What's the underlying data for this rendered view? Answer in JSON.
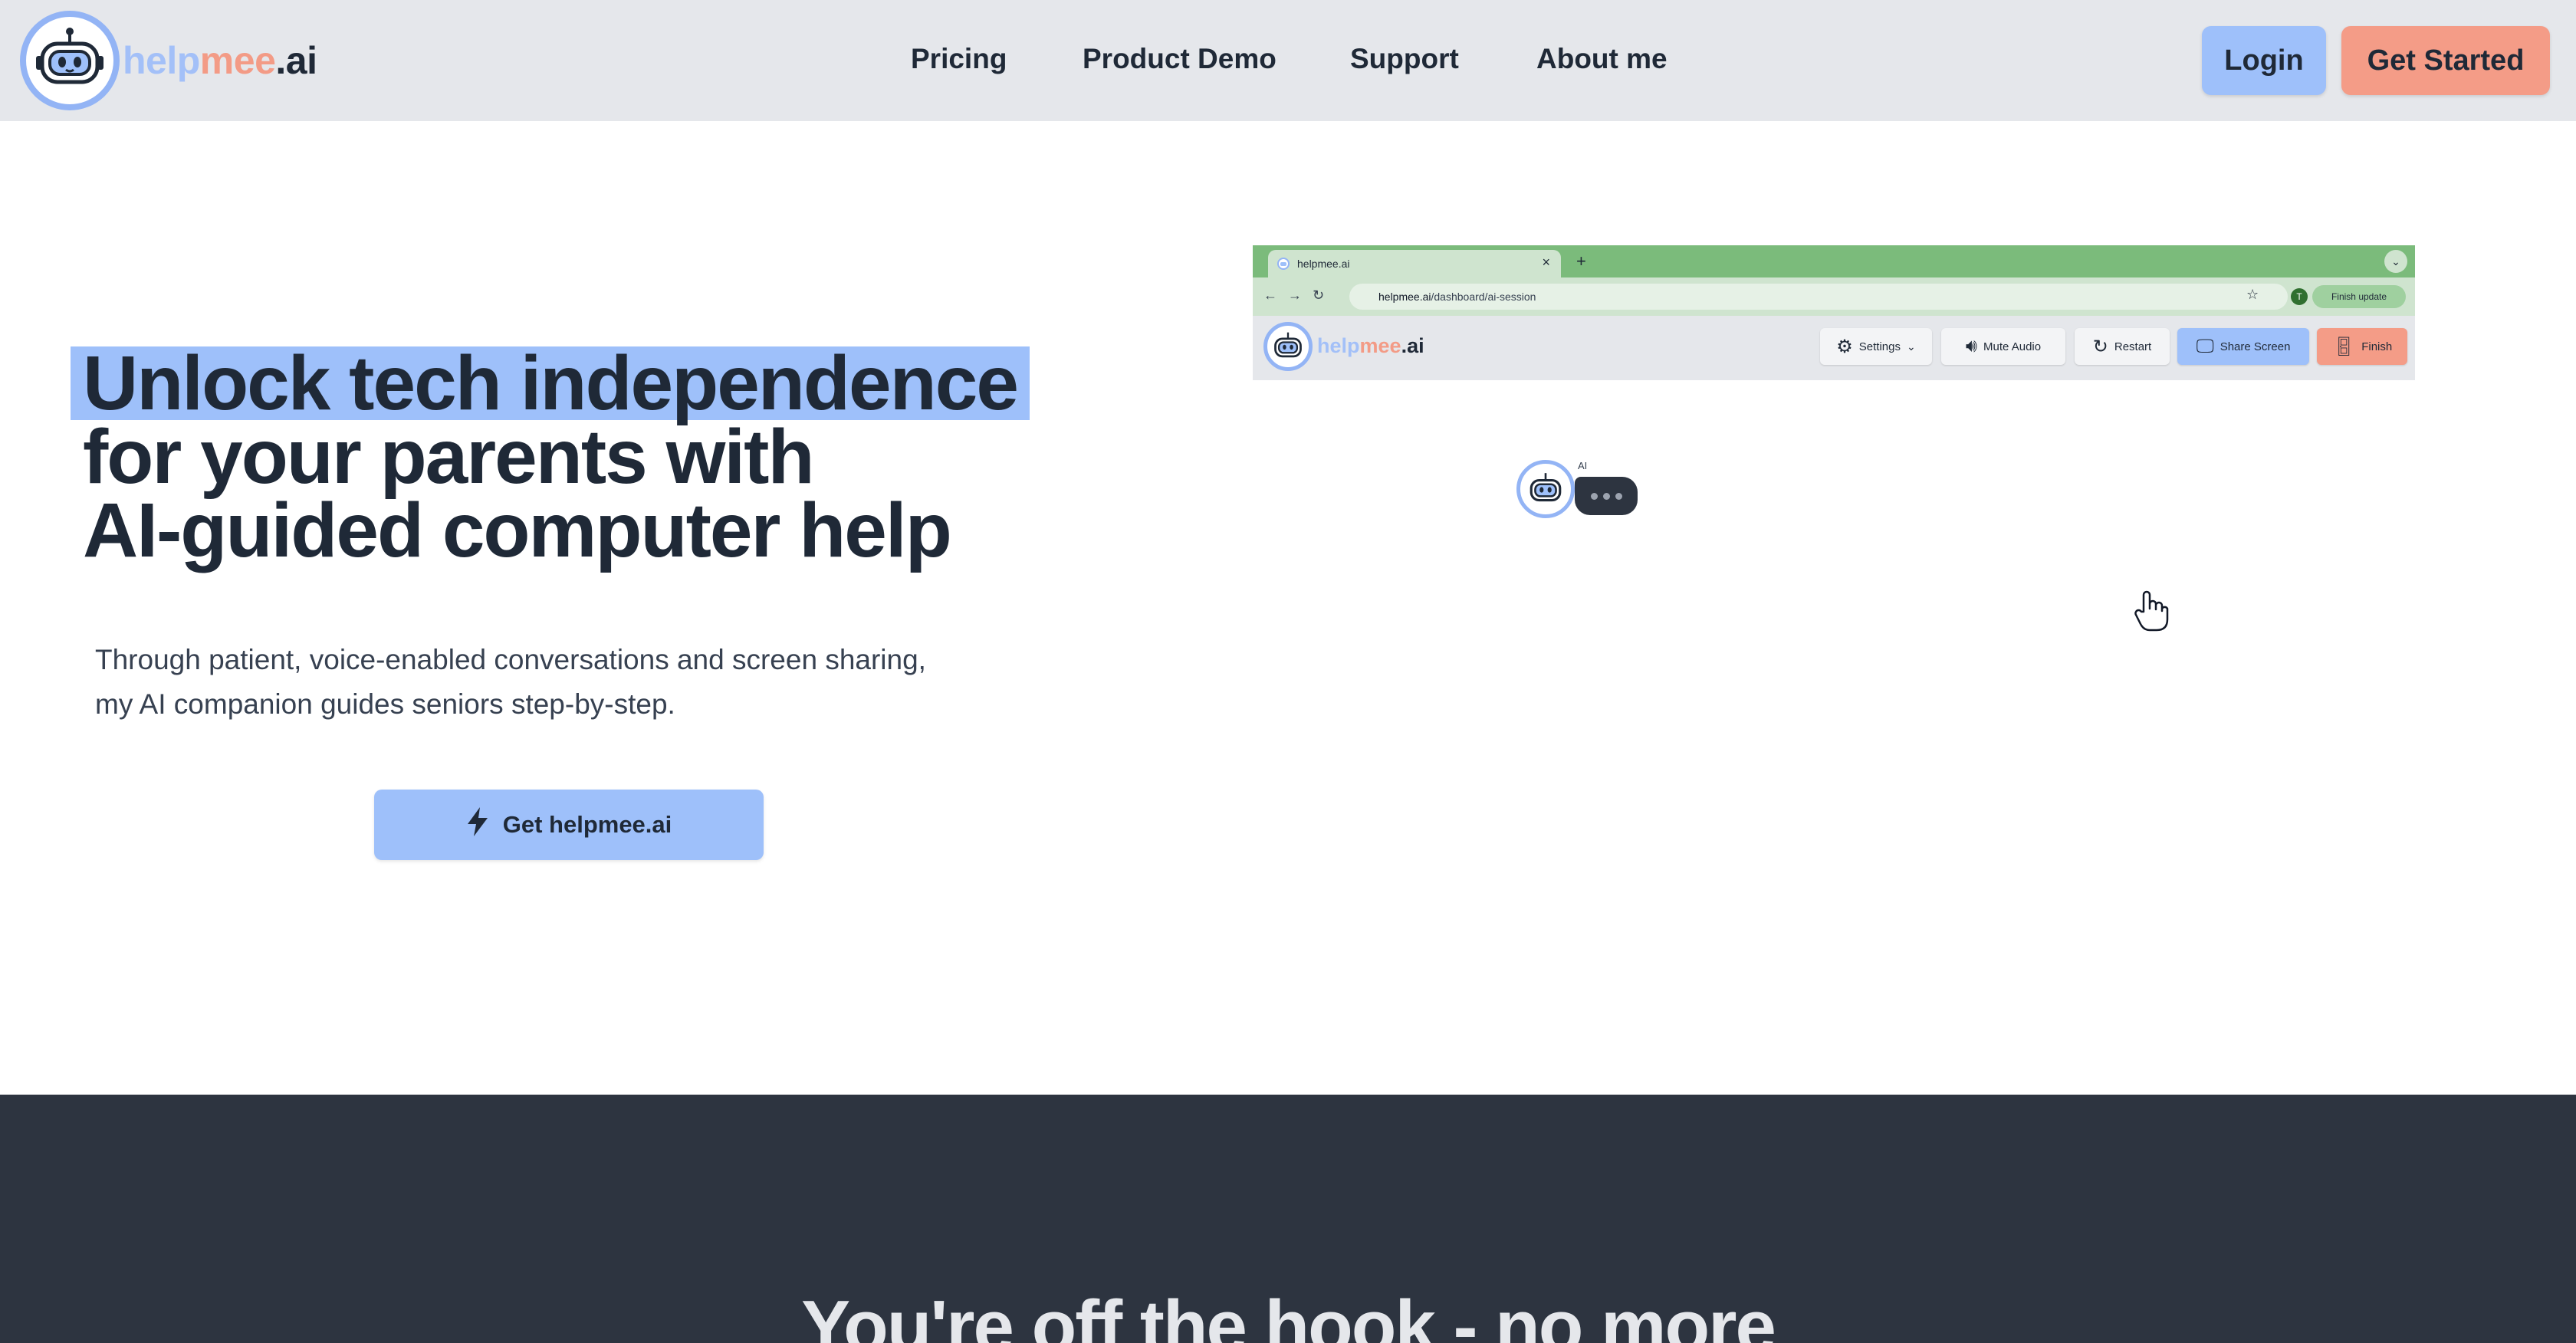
{
  "brand": {
    "part1": "help",
    "part2": "mee",
    "part3": ".ai"
  },
  "nav": {
    "links": [
      "Pricing",
      "Product Demo",
      "Support",
      "About me"
    ],
    "login": "Login",
    "get_started": "Get Started"
  },
  "hero": {
    "title_line1": "Unlock tech independence",
    "title_line2": "for your parents with",
    "title_line3": "AI-guided computer help",
    "subtitle_line1": "Through patient, voice-enabled conversations and screen sharing,",
    "subtitle_line2": "my AI companion guides seniors step-by-step.",
    "cta": "Get helpmee.ai"
  },
  "demo": {
    "tab_title": "helpmee.ai",
    "url_host": "helpmee.ai",
    "url_path": "/dashboard/ai-session",
    "profile_initial": "T",
    "finish_update": "Finish update",
    "brand": {
      "part1": "help",
      "part2": "mee",
      "part3": ".ai"
    },
    "buttons": {
      "settings": "Settings",
      "mute": "Mute Audio",
      "restart": "Restart",
      "share": "Share Screen",
      "finish": "Finish"
    },
    "ai_label": "AI"
  },
  "section2": {
    "title": "You're off the hook - no more"
  },
  "colors": {
    "accent_blue": "#9ec0fa",
    "accent_coral": "#f49c87",
    "dark": "#2d3440",
    "browser_green": "#7bbb7b"
  }
}
